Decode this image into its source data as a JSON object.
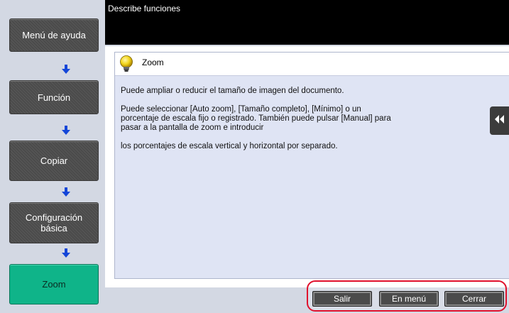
{
  "header": {
    "title": "Describe funciones"
  },
  "nav": {
    "items": [
      {
        "label": "Menú de ayuda",
        "active": false
      },
      {
        "label": "Función",
        "active": false
      },
      {
        "label": "Copiar",
        "active": false
      },
      {
        "label": "Configuración básica",
        "active": false
      },
      {
        "label": "Zoom",
        "active": true
      }
    ]
  },
  "panel": {
    "icon": "lightbulb-icon",
    "title": "Zoom",
    "paragraphs": [
      "Puede ampliar o reducir el tamaño de imagen del documento.",
      "Puede seleccionar [Auto zoom], [Tamaño completo], [Mínimo] o un porcentaje de escala fijo o registrado. También puede pulsar [Manual] para pasar a la pantalla de zoom e introducir",
      "los porcentajes de escala vertical y horizontal por separado."
    ]
  },
  "footer": {
    "exit_label": "Salir",
    "menu_label": "En menú",
    "close_label": "Cerrar"
  },
  "colors": {
    "active_nav": "#0fb489",
    "highlight": "#e0102c",
    "panel_bg": "#dfe4f4"
  }
}
